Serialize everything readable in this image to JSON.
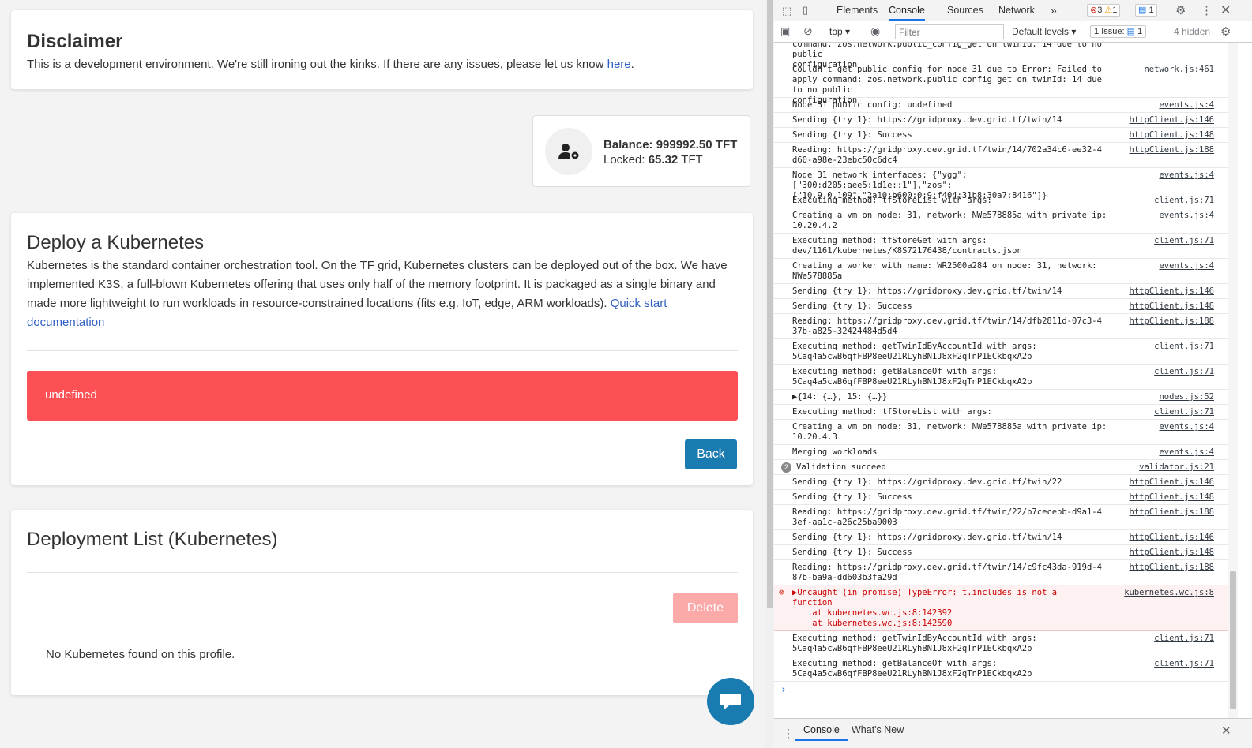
{
  "disclaimer": {
    "title": "Disclaimer",
    "text": "This is a development environment. We're still ironing out the kinks. If there are any issues, please let us know ",
    "link": "here",
    "period": "."
  },
  "balance": {
    "balance_label": "Balance:",
    "balance_value": "999992.50 TFT",
    "locked_label": "Locked:",
    "locked_value": "65.32",
    "locked_unit": "TFT"
  },
  "deploy": {
    "title": "Deploy a Kubernetes",
    "description": "Kubernetes is the standard container orchestration tool. On the TF grid, Kubernetes clusters can be deployed out of the box. We have implemented K3S, a full-blown Kubernetes offering that uses only half of the memory footprint. It is packaged as a single binary and made more lightweight to run workloads in resource-constrained locations (fits e.g. IoT, edge, ARM workloads). ",
    "doc_link": "Quick start documentation",
    "error_banner": "undefined",
    "back_button": "Back"
  },
  "deployment_list": {
    "title": "Deployment List (Kubernetes)",
    "delete_button": "Delete",
    "empty_text": "No Kubernetes found on this profile."
  },
  "devtools": {
    "tabs": [
      "Elements",
      "Console",
      "Sources",
      "Network"
    ],
    "active_tab": "Console",
    "more_tabs": "»",
    "error_count": "3",
    "warning_count": "1",
    "info_count": "1",
    "context": "top",
    "filter_placeholder": "Filter",
    "levels": "Default levels",
    "issues_label": "1 Issue:",
    "issues_count": "1",
    "hidden": "4 hidden",
    "drawer_tabs": [
      "Console",
      "What's New"
    ],
    "logs": [
      {
        "msg": "command: zos.network.public_config_get on twinId: 14 due to no public\nconfiguration",
        "src": "",
        "h": 32
      },
      {
        "msg": "Couldn't get public config for node 31 due to Error: Failed to\napply command: zos.network.public_config_get on twinId: 14 due to no public\nconfiguration",
        "src": "network.js:461",
        "h": 45
      },
      {
        "msg": "Node 31 public config: undefined",
        "src": "events.js:4",
        "h": 19
      },
      {
        "msg": "Sending {try 1}: https://gridproxy.dev.grid.tf/twin/14",
        "src": "httpClient.js:146",
        "h": 19
      },
      {
        "msg": "Sending {try 1}: Success",
        "src": "httpClient.js:148",
        "h": 19
      },
      {
        "msg": "Reading: https://gridproxy.dev.grid.tf/twin/14/702a34c6-ee32-4\nd60-a98e-23ebc50c6dc4",
        "src": "httpClient.js:188",
        "h": 32
      },
      {
        "msg": "Node 31 network interfaces: {\"ygg\":[\"300:d205:aee5:1d1e::1\"],\"zos\":\n[\"10.9.0.109\",\"2a10:b600:0:9:f404:31b8:30a7:8416\"]}",
        "src": "events.js:4",
        "h": 32
      },
      {
        "msg": "Executing method: tfStoreList with args:",
        "src": "client.js:71",
        "h": 19
      },
      {
        "msg": "Creating a vm on node: 31, network: NWe578885a with private ip:\n10.20.4.2",
        "src": "events.js:4",
        "h": 32
      },
      {
        "msg": "Executing method: tfStoreGet with args:\ndev/1161/kubernetes/K8S72176438/contracts.json",
        "src": "client.js:71",
        "h": 32
      },
      {
        "msg": "Creating a worker with name: WR2500a284 on node: 31, network:\nNWe578885a",
        "src": "events.js:4",
        "h": 32
      },
      {
        "msg": "Sending {try 1}: https://gridproxy.dev.grid.tf/twin/14",
        "src": "httpClient.js:146",
        "h": 19
      },
      {
        "msg": "Sending {try 1}: Success",
        "src": "httpClient.js:148",
        "h": 19
      },
      {
        "msg": "Reading: https://gridproxy.dev.grid.tf/twin/14/dfb2811d-07c3-4\n37b-a825-32424484d5d4",
        "src": "httpClient.js:188",
        "h": 32
      },
      {
        "msg": "Executing method: getTwinIdByAccountId with args:\n5Caq4a5cwB6qfFBP8eeU21RLyhBN1J8xF2qTnP1ECkbqxA2p",
        "src": "client.js:71",
        "h": 32
      },
      {
        "msg": "Executing method: getBalanceOf with args:\n5Caq4a5cwB6qfFBP8eeU21RLyhBN1J8xF2qTnP1ECkbqxA2p",
        "src": "client.js:71",
        "h": 32
      },
      {
        "msg": "▶{14: {…}, 15: {…}}",
        "src": "nodes.js:52",
        "h": 19
      },
      {
        "msg": "Executing method: tfStoreList with args:",
        "src": "client.js:71",
        "h": 19
      },
      {
        "msg": "Creating a vm on node: 31, network: NWe578885a with private ip:\n10.20.4.3",
        "src": "events.js:4",
        "h": 32
      },
      {
        "msg": "Merging workloads",
        "src": "events.js:4",
        "h": 19
      },
      {
        "msg": "Validation succeed",
        "src": "validator.js:21",
        "h": 19,
        "badge": "2"
      },
      {
        "msg": "Sending {try 1}: https://gridproxy.dev.grid.tf/twin/22",
        "src": "httpClient.js:146",
        "h": 19
      },
      {
        "msg": "Sending {try 1}: Success",
        "src": "httpClient.js:148",
        "h": 19
      },
      {
        "msg": "Reading: https://gridproxy.dev.grid.tf/twin/22/b7cecebb-d9a1-4\n3ef-aa1c-a26c25ba9003",
        "src": "httpClient.js:188",
        "h": 32
      },
      {
        "msg": "Sending {try 1}: https://gridproxy.dev.grid.tf/twin/14",
        "src": "httpClient.js:146",
        "h": 19
      },
      {
        "msg": "Sending {try 1}: Success",
        "src": "httpClient.js:148",
        "h": 19
      },
      {
        "msg": "Reading: https://gridproxy.dev.grid.tf/twin/14/c9fc43da-919d-4\n87b-ba9a-dd603b3fa29d",
        "src": "httpClient.js:188",
        "h": 32
      },
      {
        "msg": "▶Uncaught (in promise) TypeError: t.includes is not a\nfunction\n    at kubernetes.wc.js:8:142392\n    at kubernetes.wc.js:8:142590",
        "src": "kubernetes.wc.js:8",
        "h": 58,
        "error": true
      },
      {
        "msg": "Executing method: getTwinIdByAccountId with args:\n5Caq4a5cwB6qfFBP8eeU21RLyhBN1J8xF2qTnP1ECkbqxA2p",
        "src": "client.js:71",
        "h": 32
      },
      {
        "msg": "Executing method: getBalanceOf with args:\n5Caq4a5cwB6qfFBP8eeU21RLyhBN1J8xF2qTnP1ECkbqxA2p",
        "src": "client.js:71",
        "h": 32
      }
    ],
    "prompt": "›"
  },
  "colors": {
    "error_banner": "#fc5054",
    "back_button": "#1a7bb1",
    "delete_button": "#fcaaa9",
    "chat_button": "#1a7bb1"
  }
}
